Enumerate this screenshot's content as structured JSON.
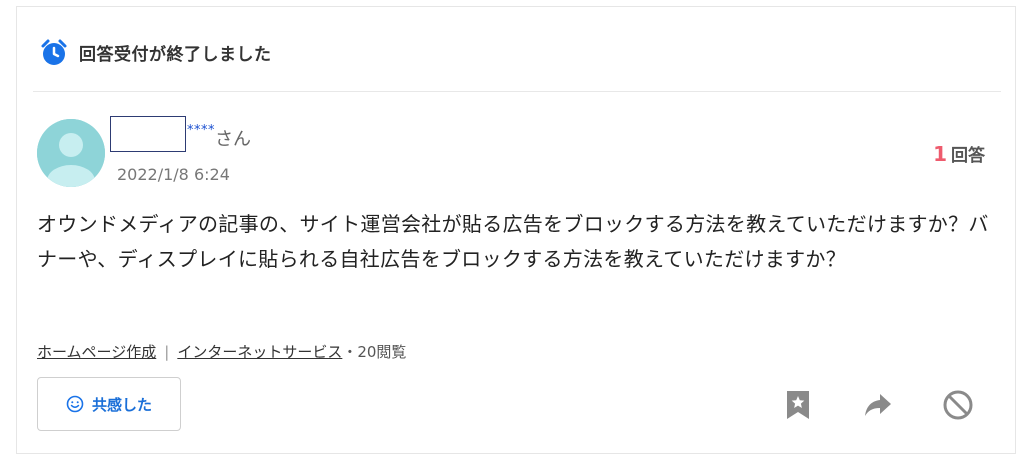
{
  "status": {
    "icon": "alarm-clock-icon",
    "label": "回答受付が終了しました",
    "icon_color": "#1a73e8"
  },
  "question": {
    "author_mask": "****",
    "author_suffix": "さん",
    "date": "2022/1/8 6:24",
    "answer_count": "1",
    "answer_label": "回答",
    "body": "オウンドメディアの記事の、サイト運営会社が貼る広告をブロックする方法を教えていただけますか？バナーや、ディスプレイに貼られる自社広告をブロックする方法を教えていただけますか？"
  },
  "meta": {
    "categories": [
      "ホームページ作成",
      "インターネットサービス"
    ],
    "separator": "|",
    "views": "・20閲覧"
  },
  "actions": {
    "sympathy_label": "共感した",
    "icons": [
      "bookmark-star-icon",
      "share-arrow-icon",
      "block-icon"
    ]
  },
  "colors": {
    "accent": "#1a73e8",
    "answer_count": "#ee5b6d",
    "avatar": "#8ed4d8"
  }
}
